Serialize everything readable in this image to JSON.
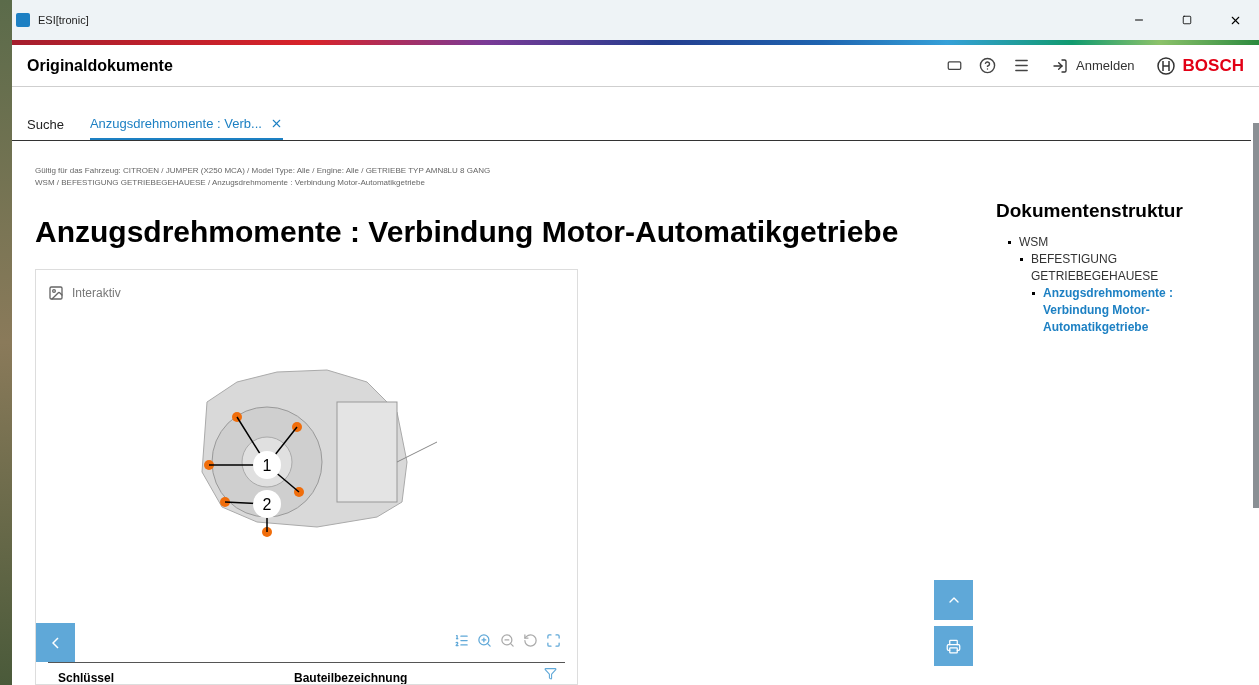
{
  "window": {
    "title": "ESI[tronic]"
  },
  "header": {
    "title": "Originaldokumente",
    "login": "Anmelden",
    "brand": "BOSCH"
  },
  "tabs": [
    {
      "label": "Suche",
      "selected": false
    },
    {
      "label": "Anzugsdrehmomente : Verb...",
      "selected": true
    }
  ],
  "breadcrumbs": [
    "Gültig für das Fahrzeug: CITROEN / JUMPER (X250 MCA) / Model Type: Alle / Engine: Alle / GETRIEBE TYP AMN8LU 8 GANG",
    "WSM / BEFESTIGUNG GETRIEBEGEHAUESE / Anzugsdrehmomente : Verbindung Motor-Automatikgetriebe"
  ],
  "document_title": "Anzugsdrehmomente : Verbindung Motor-Automatikgetriebe",
  "viewer": {
    "mode_label": "Interaktiv",
    "callouts": [
      "1",
      "2"
    ]
  },
  "table": {
    "columns": [
      "Schlüssel",
      "Bauteilbezeichnung"
    ]
  },
  "structure": {
    "title": "Dokumentenstruktur",
    "items": [
      {
        "label": "WSM",
        "selected": false,
        "children": [
          {
            "label": "BEFESTIGUNG GETRIEBEGEHAUESE",
            "selected": false,
            "children": [
              {
                "label": "Anzugsdrehmomente : Verbindung Motor-Automatikgetriebe",
                "selected": true
              }
            ]
          }
        ]
      }
    ]
  }
}
